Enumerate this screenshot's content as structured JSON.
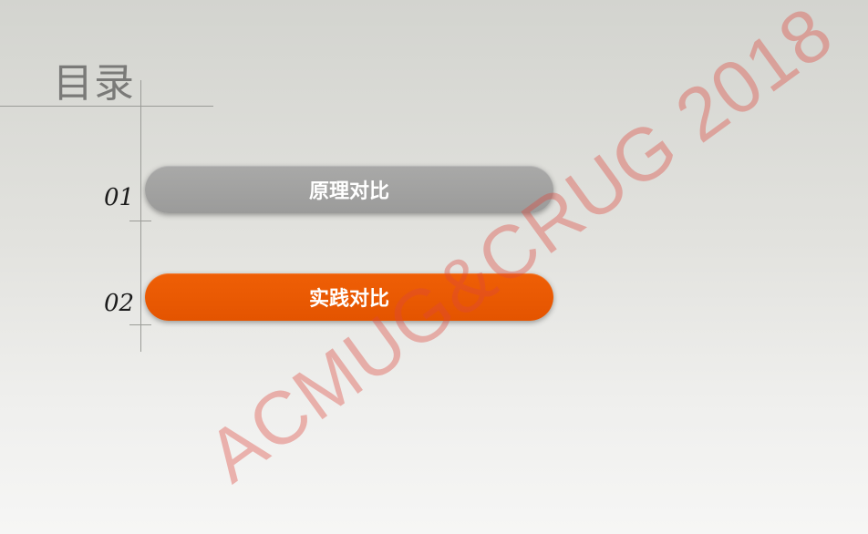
{
  "slide": {
    "title": "目录",
    "items": [
      {
        "number": "01",
        "label": "原理对比",
        "color": "#9e9e9d"
      },
      {
        "number": "02",
        "label": "实践对比",
        "color": "#e85800"
      }
    ]
  },
  "watermark": {
    "text": "ACMUG&CRUG 2018",
    "color": "#e05a50"
  }
}
